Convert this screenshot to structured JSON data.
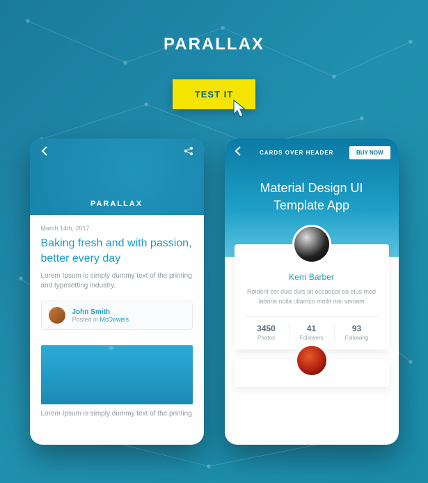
{
  "page": {
    "title": "PARALLAX",
    "test_button": "TEST IT"
  },
  "phone1": {
    "hero_label": "PARALLAX",
    "date": "March 14th, 2017",
    "headline": "Baking fresh and with passion, better every day",
    "description": "Lorem Ipsum is simply dummy text of the printing and typesetting industry.",
    "author": {
      "name": "John Smith",
      "posted_in_prefix": "Posted in ",
      "posted_in_link": "McDowels"
    },
    "bottom_text": "Lorem Ipsum is simply dummy text of the printing"
  },
  "phone2": {
    "topbar_title": "CARDS OVER HEADER",
    "buy_button": "BUY NOW",
    "hero_title": "Material Design UI Template App",
    "profile": {
      "name": "Kerri Barber",
      "bio": "Roident est duis duis sit occaecat ea eius mod laboris nulla ullamco mollit nisi veniam",
      "stats": [
        {
          "value": "3450",
          "label": "Photos"
        },
        {
          "value": "41",
          "label": "Followers"
        },
        {
          "value": "93",
          "label": "Following"
        }
      ]
    }
  }
}
